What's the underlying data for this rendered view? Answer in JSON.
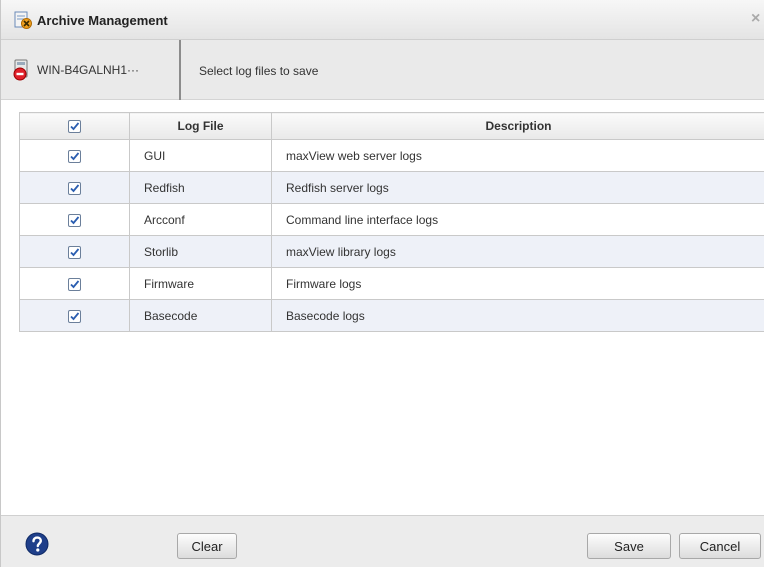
{
  "window": {
    "title": "Archive Management",
    "close_label": "×"
  },
  "subheader": {
    "server_name": "WIN-B4GALNH1···",
    "instruction": "Select log files to save"
  },
  "table": {
    "headers": [
      "Log File",
      "Description"
    ],
    "header_checked": true,
    "rows": [
      {
        "checked": true,
        "file": "GUI",
        "description": "maxView web server logs"
      },
      {
        "checked": true,
        "file": "Redfish",
        "description": "Redfish server logs"
      },
      {
        "checked": true,
        "file": "Arcconf",
        "description": "Command line interface logs"
      },
      {
        "checked": true,
        "file": "Storlib",
        "description": "maxView library logs"
      },
      {
        "checked": true,
        "file": "Firmware",
        "description": "Firmware logs"
      },
      {
        "checked": true,
        "file": "Basecode",
        "description": "Basecode logs"
      }
    ]
  },
  "footer": {
    "help_icon": "help-icon",
    "clear_label": "Clear",
    "save_label": "Save",
    "cancel_label": "Cancel"
  },
  "colors": {
    "alt_row": "#eef1f8",
    "checkbox_border": "#6b7f9a",
    "check_mark": "#2a5db0"
  }
}
